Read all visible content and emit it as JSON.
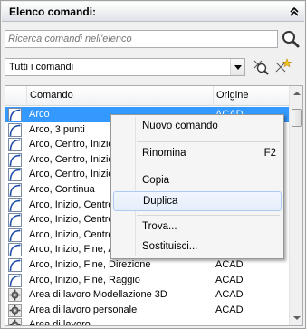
{
  "panel": {
    "title": "Elenco comandi:",
    "collapse_icon": "double-chevron-up-icon"
  },
  "search": {
    "placeholder": "Ricerca comandi nell'elenco",
    "button_icon": "magnifier-icon"
  },
  "filter": {
    "selected": "Tutti i comandi",
    "icons": [
      "find-command-icon",
      "new-command-icon"
    ]
  },
  "list": {
    "columns": {
      "command": "Comando",
      "origin": "Origine"
    },
    "rows": [
      {
        "name": "Arco",
        "origin": "ACAD",
        "icon": "arc-icon",
        "selected": true
      },
      {
        "name": "Arco, 3 punti",
        "origin": "",
        "icon": "arc-icon"
      },
      {
        "name": "Arco, Centro, Inizio",
        "origin": "",
        "icon": "arc-icon"
      },
      {
        "name": "Arco, Centro, Inizio",
        "origin": "",
        "icon": "arc-icon"
      },
      {
        "name": "Arco, Centro, Inizio",
        "origin": "",
        "icon": "arc-icon"
      },
      {
        "name": "Arco, Continua",
        "origin": "",
        "icon": "arc-icon"
      },
      {
        "name": "Arco, Inizio, Centro",
        "origin": "",
        "icon": "arc-icon"
      },
      {
        "name": "Arco, Inizio, Centro",
        "origin": "",
        "icon": "arc-icon"
      },
      {
        "name": "Arco, Inizio, Centro",
        "origin": "",
        "icon": "arc-icon"
      },
      {
        "name": "Arco, Inizio, Fine, A",
        "origin": "",
        "icon": "arc-icon"
      },
      {
        "name": "Arco, Inizio, Fine, Direzione",
        "origin": "ACAD",
        "icon": "arc-icon"
      },
      {
        "name": "Arco, Inizio, Fine, Raggio",
        "origin": "ACAD",
        "icon": "arc-icon"
      },
      {
        "name": "Area di lavoro Modellazione 3D",
        "origin": "ACAD",
        "icon": "gear-icon"
      },
      {
        "name": "Area di lavoro personale",
        "origin": "ACAD",
        "icon": "gear-icon"
      },
      {
        "name": "Area di lavoro ...",
        "origin": "",
        "icon": "gear-icon"
      }
    ]
  },
  "context_menu": {
    "items": [
      {
        "label": "Nuovo comando",
        "shortcut": ""
      },
      {
        "label": "Rinomina",
        "shortcut": "F2"
      },
      {
        "label": "Copia",
        "shortcut": ""
      },
      {
        "label": "Duplica",
        "shortcut": "",
        "highlighted": true
      },
      {
        "label": "Trova...",
        "shortcut": ""
      },
      {
        "label": "Sostituisci...",
        "shortcut": ""
      }
    ]
  },
  "colors": {
    "selection": "#3399ff",
    "highlight_border": "#aeccf1"
  }
}
